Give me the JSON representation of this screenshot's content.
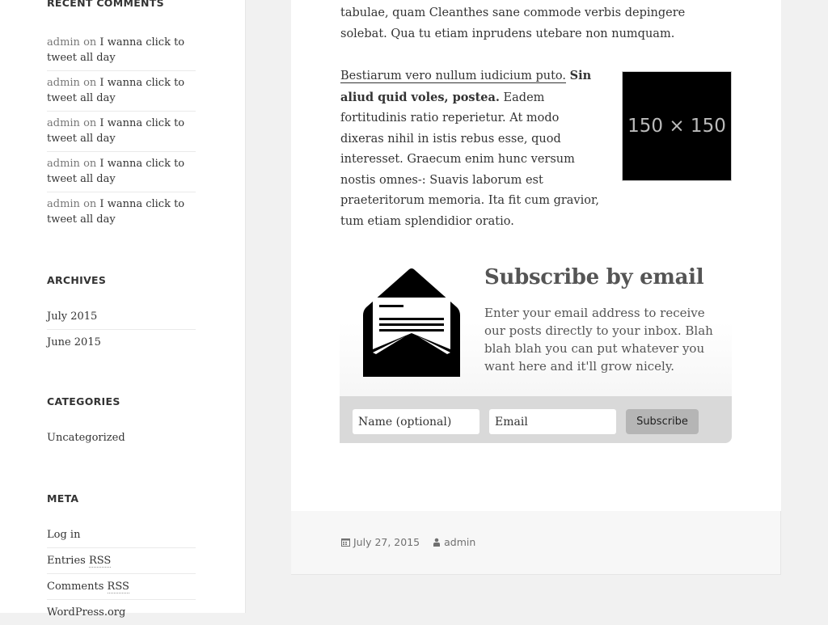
{
  "sidebar": {
    "recent_comments": {
      "title": "Recent Comments",
      "items": [
        {
          "author": "admin",
          "on": "on",
          "post": "I wanna click to tweet all day"
        },
        {
          "author": "admin",
          "on": "on",
          "post": "I wanna click to tweet all day"
        },
        {
          "author": "admin",
          "on": "on",
          "post": "I wanna click to tweet all day"
        },
        {
          "author": "admin",
          "on": "on",
          "post": "I wanna click to tweet all day"
        },
        {
          "author": "admin",
          "on": "on",
          "post": "I wanna click to tweet all day"
        }
      ]
    },
    "archives": {
      "title": "Archives",
      "items": [
        "July 2015",
        "June 2015"
      ]
    },
    "categories": {
      "title": "Categories",
      "items": [
        "Uncategorized"
      ]
    },
    "meta": {
      "title": "Meta",
      "items": [
        {
          "text": "Log in"
        },
        {
          "text": "Entries ",
          "abbr": "RSS"
        },
        {
          "text": "Comments ",
          "abbr": "RSS"
        },
        {
          "text": "WordPress.org"
        }
      ]
    }
  },
  "article": {
    "para1": "tabulae, quam Cleanthes sane commode verbis depingere solebat. Qua tu etiam inprudens utebare non numquam.",
    "para2_link": "Bestiarum vero nullum iudicium puto.",
    "para2_bold": "Sin aliud quid voles, postea.",
    "para2_rest": " Eadem fortitudinis ratio reperietur. At modo dixeras nihil in istis rebus esse, quod interesset. Graecum enim hunc versum nostis omnes-: Suavis laborum est praeteritorum memoria. Ita fit cum gravior, tum etiam splendidior oratio.",
    "thumbnail_label": "150 × 150",
    "subscribe": {
      "icon": "envelope-open-icon",
      "title": "Subscribe by email",
      "description": "Enter your email address to receive our posts directly to your inbox. Blah blah blah you can put whatever you want here and it'll grow nicely.",
      "name_placeholder": "Name (optional)",
      "email_placeholder": "Email",
      "button_label": "Subscribe"
    },
    "footer": {
      "date_icon": "calendar-icon",
      "date": "July 27, 2015",
      "author_icon": "user-icon",
      "author": "admin"
    }
  }
}
